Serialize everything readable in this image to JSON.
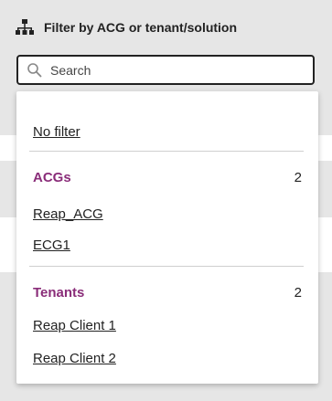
{
  "header": {
    "title": "Filter by ACG or tenant/solution",
    "icon": "hierarchy-icon"
  },
  "search": {
    "placeholder": "Search",
    "value": ""
  },
  "dropdown": {
    "no_filter": "No filter",
    "acgs": {
      "label": "ACGs",
      "count": "2",
      "items": [
        "Reap_ACG",
        "ECG1"
      ]
    },
    "tenants": {
      "label": "Tenants",
      "count": "2",
      "items": [
        "Reap Client 1",
        "Reap Client 2"
      ]
    }
  },
  "colors": {
    "section_accent": "#8a2d79",
    "background": "#e6e6e6"
  }
}
